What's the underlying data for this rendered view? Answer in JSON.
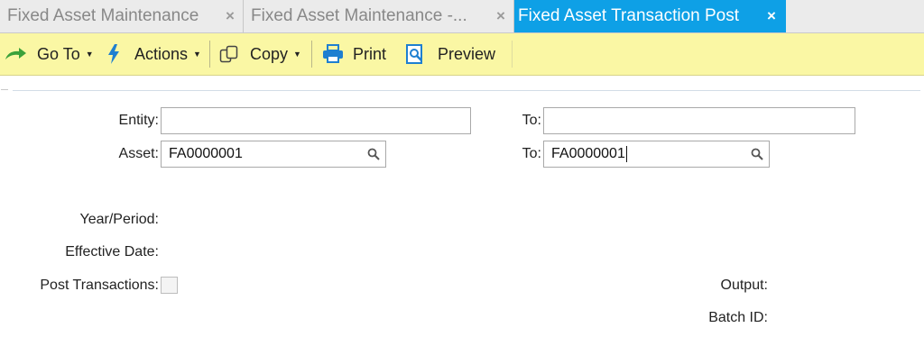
{
  "tabs": [
    {
      "label": "Fixed Asset Maintenance",
      "close": "×"
    },
    {
      "label": "Fixed Asset Maintenance -...",
      "close": "×"
    },
    {
      "label": "Fixed Asset Transaction Post",
      "close": "×"
    }
  ],
  "toolbar": {
    "goto_label": "Go To",
    "actions_label": "Actions",
    "copy_label": "Copy",
    "print_label": "Print",
    "preview_label": "Preview"
  },
  "form": {
    "entity_label": "Entity:",
    "entity_value": "",
    "entity_to_label": "To:",
    "entity_to_value": "",
    "asset_label": "Asset:",
    "asset_value": "FA0000001",
    "asset_to_label": "To:",
    "asset_to_value": "FA0000001",
    "year_period_label": "Year/Period:",
    "effective_date_label": "Effective Date:",
    "post_transactions_label": "Post Transactions:",
    "post_transactions_checked": false,
    "output_label": "Output:",
    "batch_id_label": "Batch ID:"
  },
  "colors": {
    "active_tab": "#0ea0e6",
    "toolbar_bg": "#faf7a4",
    "goto_icon": "#3aa13a",
    "actions_icon": "#1e7fd0",
    "print_icon": "#1e7fd0"
  }
}
